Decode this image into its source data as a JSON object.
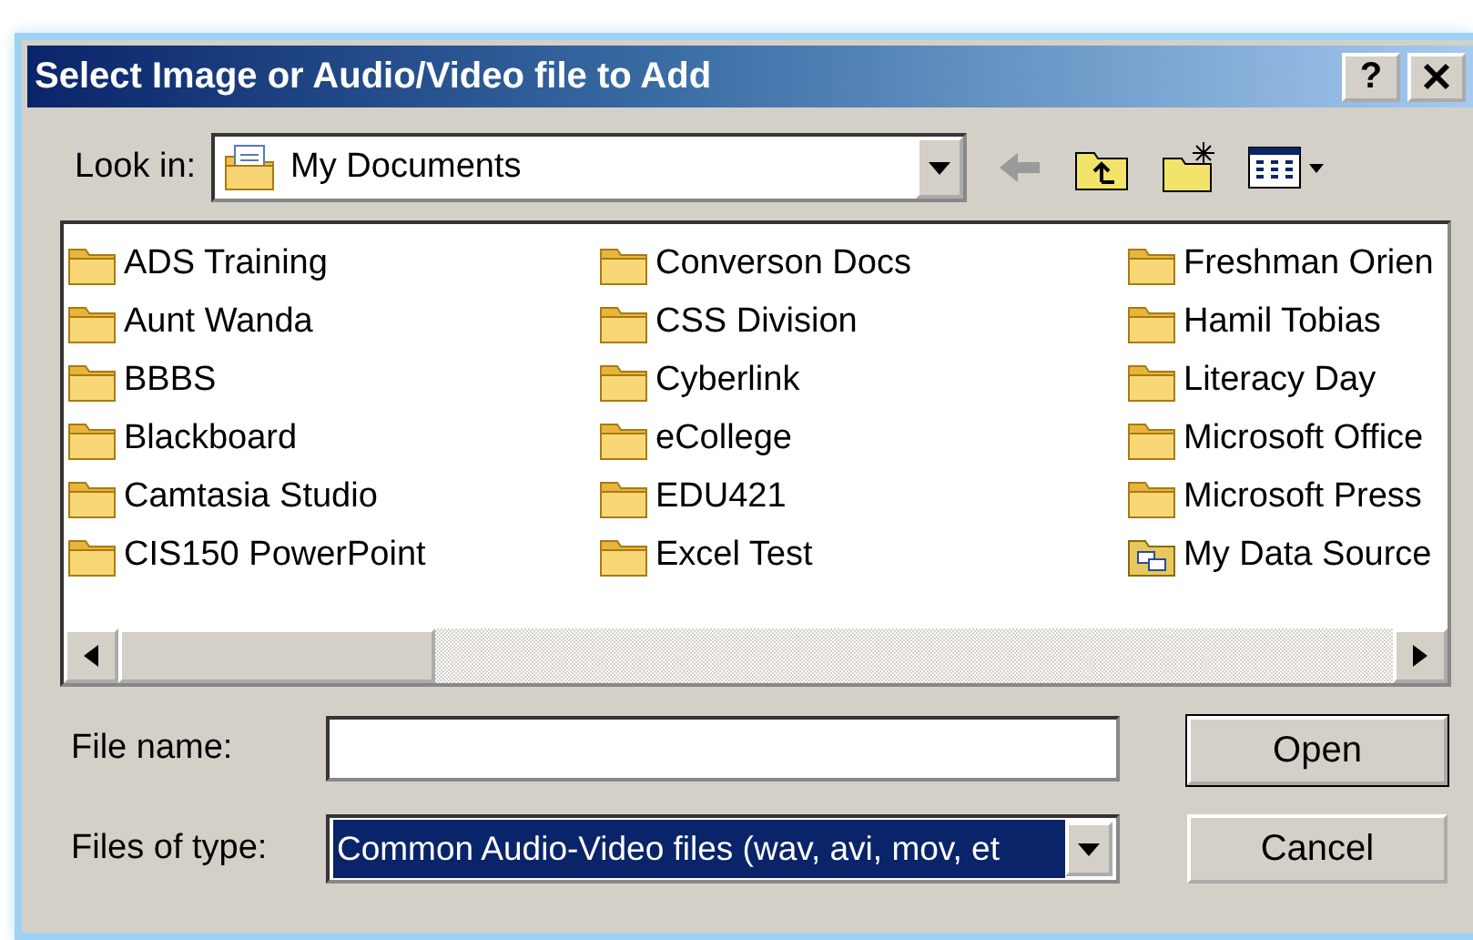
{
  "window": {
    "title": "Select Image or Audio/Video file to Add",
    "help_button": "?"
  },
  "look_in": {
    "label": "Look in:",
    "value": "My Documents"
  },
  "toolbar": [
    {
      "kind": "back",
      "disabled": true
    },
    {
      "kind": "up",
      "disabled": false
    },
    {
      "kind": "new-folder",
      "disabled": false
    },
    {
      "kind": "views",
      "disabled": false
    }
  ],
  "files": [
    {
      "name": "ADS Training",
      "kind": "folder"
    },
    {
      "name": "Aunt Wanda",
      "kind": "folder"
    },
    {
      "name": "BBBS",
      "kind": "folder"
    },
    {
      "name": "Blackboard",
      "kind": "folder"
    },
    {
      "name": "Camtasia Studio",
      "kind": "folder"
    },
    {
      "name": "CIS150 PowerPoint",
      "kind": "folder"
    },
    {
      "name": "Converson Docs",
      "kind": "folder"
    },
    {
      "name": "CSS Division",
      "kind": "folder"
    },
    {
      "name": "Cyberlink",
      "kind": "folder"
    },
    {
      "name": "eCollege",
      "kind": "folder"
    },
    {
      "name": "EDU421",
      "kind": "folder"
    },
    {
      "name": "Excel Test",
      "kind": "folder"
    },
    {
      "name": "Freshman Orien",
      "kind": "folder"
    },
    {
      "name": "Hamil Tobias",
      "kind": "folder"
    },
    {
      "name": "Literacy Day",
      "kind": "folder"
    },
    {
      "name": "Microsoft Office",
      "kind": "folder"
    },
    {
      "name": "Microsoft Press",
      "kind": "folder"
    },
    {
      "name": "My Data Source",
      "kind": "data-source"
    }
  ],
  "file_name": {
    "label": "File name:"
  },
  "file_type": {
    "label": "Files of type:",
    "value": "Common Audio-Video files (wav, avi, mov, et",
    "highlighted": true
  },
  "buttons": [
    {
      "label": "Open",
      "default": true
    },
    {
      "label": "Cancel",
      "default": false
    }
  ]
}
